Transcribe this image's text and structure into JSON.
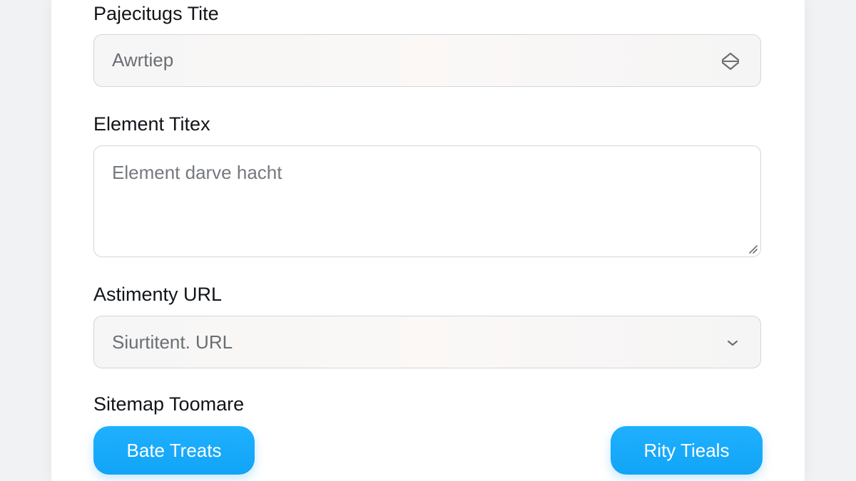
{
  "form": {
    "page_title": {
      "label": "Pajecitugs Tite",
      "value": "Awrtiep"
    },
    "element_text": {
      "label": "Element Titex",
      "placeholder": "Element darve hacht"
    },
    "assignment_url": {
      "label": "Astimenty URL",
      "value": "Siurtitent. URL"
    },
    "sitemap": {
      "label": "Sitemap Toomare"
    }
  },
  "buttons": {
    "left_label": "Bate Treats",
    "right_label": "Rity Tieals"
  },
  "icons": {
    "select_1": "up-down-arrows-icon",
    "select_2": "chevron-down-icon",
    "textarea": "resize-handle-icon"
  },
  "colors": {
    "accent": "#12a4f6",
    "field_border": "#d3d6da",
    "label_text": "#111418",
    "value_text": "#6a6e73"
  }
}
